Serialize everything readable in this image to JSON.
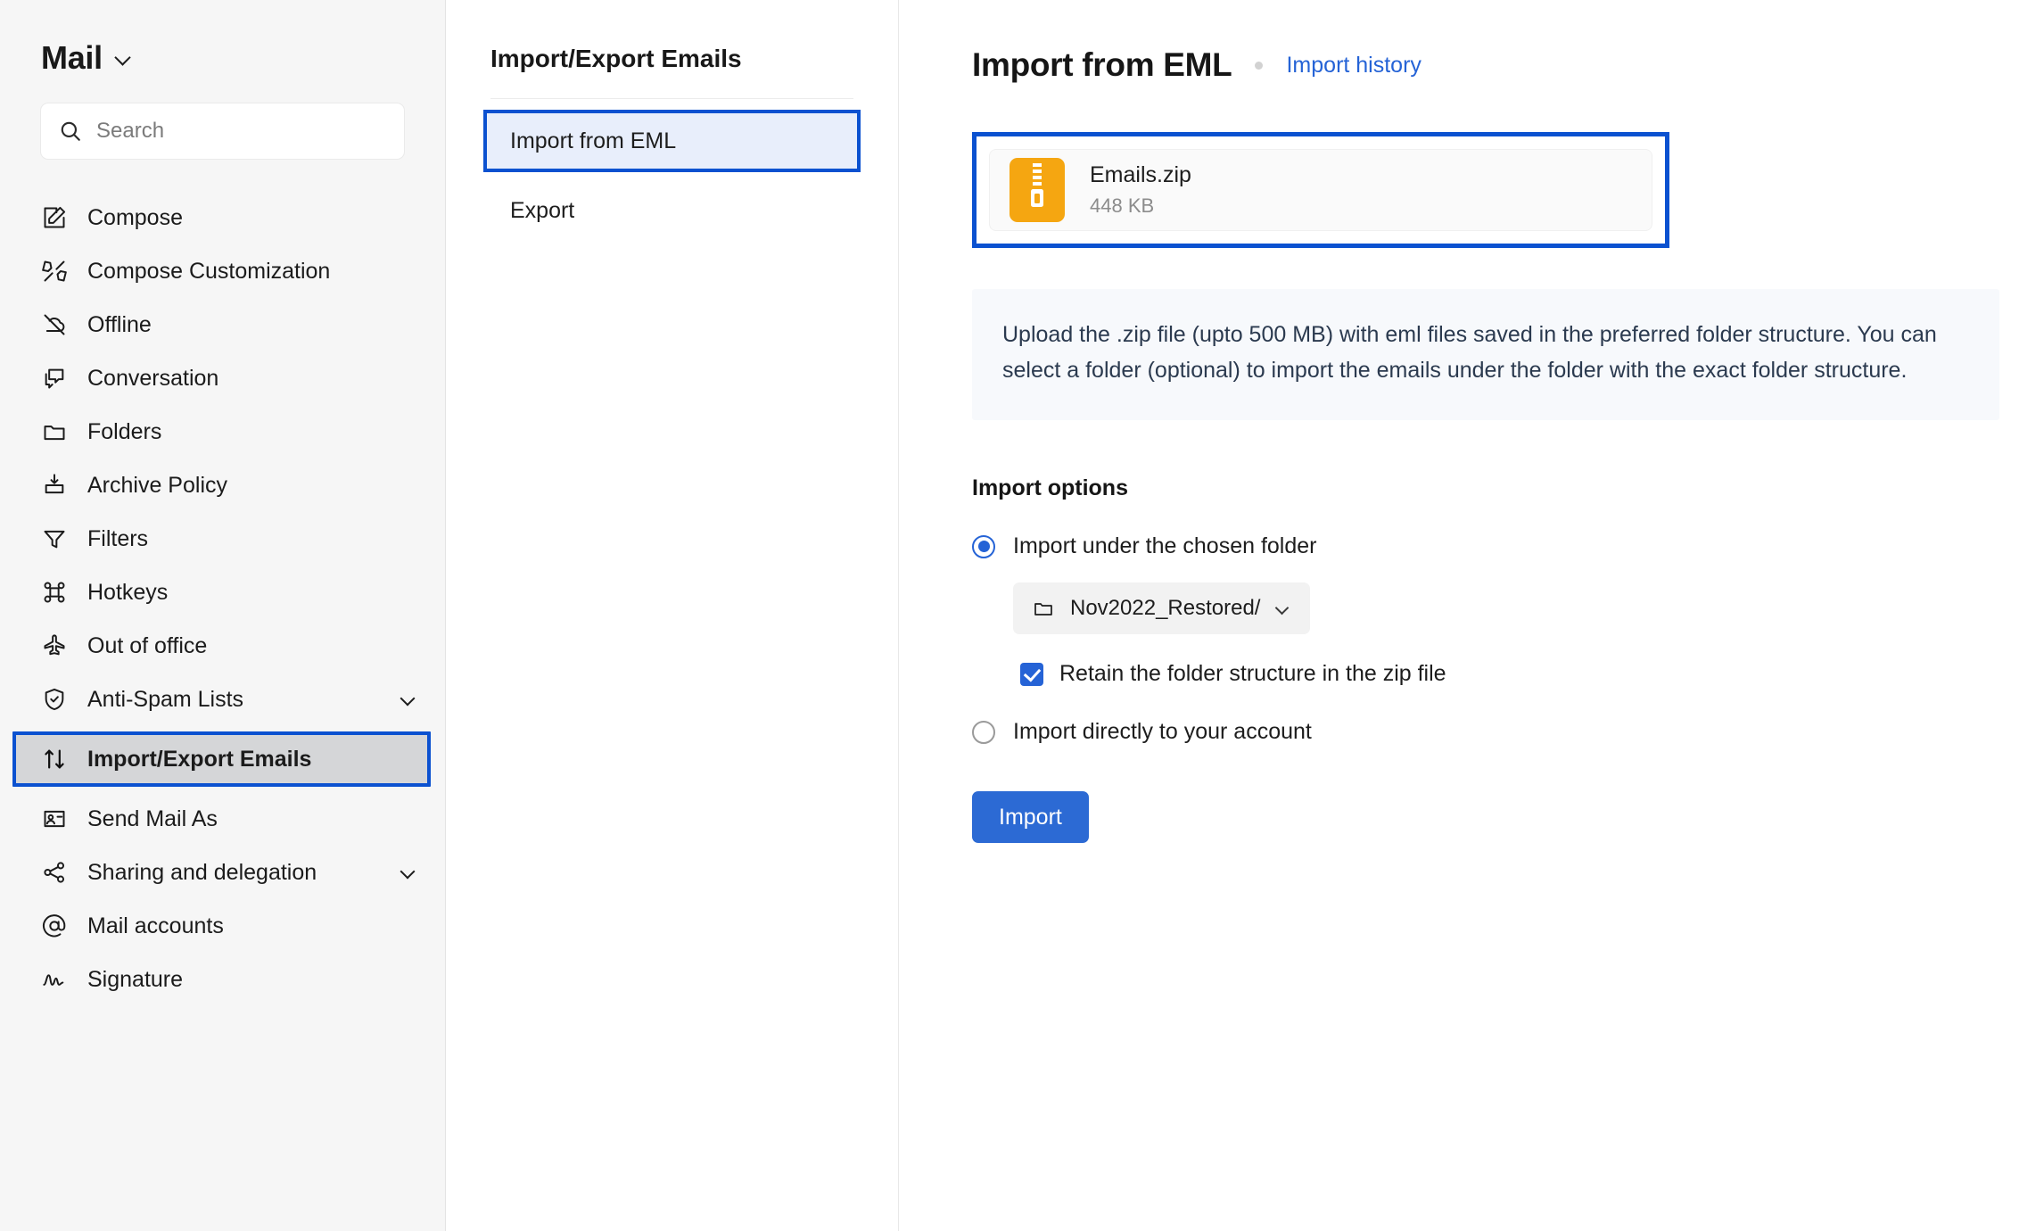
{
  "sidebar": {
    "title": "Mail",
    "search_placeholder": "Search",
    "items": [
      {
        "label": "Compose",
        "icon": "compose-icon",
        "chevron": false,
        "active": false
      },
      {
        "label": "Compose Customization",
        "icon": "tools-icon",
        "chevron": false,
        "active": false
      },
      {
        "label": "Offline",
        "icon": "cloud-off-icon",
        "chevron": false,
        "active": false
      },
      {
        "label": "Conversation",
        "icon": "chat-icon",
        "chevron": false,
        "active": false
      },
      {
        "label": "Folders",
        "icon": "folder-icon",
        "chevron": false,
        "active": false
      },
      {
        "label": "Archive Policy",
        "icon": "archive-icon",
        "chevron": false,
        "active": false
      },
      {
        "label": "Filters",
        "icon": "funnel-icon",
        "chevron": false,
        "active": false
      },
      {
        "label": "Hotkeys",
        "icon": "command-icon",
        "chevron": false,
        "active": false
      },
      {
        "label": "Out of office",
        "icon": "airplane-icon",
        "chevron": false,
        "active": false
      },
      {
        "label": "Anti-Spam Lists",
        "icon": "shield-check-icon",
        "chevron": true,
        "active": false
      },
      {
        "label": "Import/Export Emails",
        "icon": "arrows-up-down-icon",
        "chevron": false,
        "active": true
      },
      {
        "label": "Send Mail As",
        "icon": "contact-card-icon",
        "chevron": false,
        "active": false
      },
      {
        "label": "Sharing and delegation",
        "icon": "share-nodes-icon",
        "chevron": true,
        "active": false
      },
      {
        "label": "Mail accounts",
        "icon": "at-sign-icon",
        "chevron": false,
        "active": false
      },
      {
        "label": "Signature",
        "icon": "signature-icon",
        "chevron": false,
        "active": false
      }
    ]
  },
  "midpanel": {
    "title": "Import/Export Emails",
    "items": [
      {
        "label": "Import from EML",
        "active": true
      },
      {
        "label": "Export",
        "active": false
      }
    ]
  },
  "main": {
    "title": "Import from EML",
    "history_link": "Import history",
    "file": {
      "name": "Emails.zip",
      "size": "448 KB",
      "icon": "zip-file-icon",
      "icon_color": "#f5a611"
    },
    "info_text": "Upload the .zip file (upto 500 MB) with eml files saved in the preferred folder structure. You can select a folder (optional) to import the emails under the folder with the exact folder structure.",
    "options": {
      "heading": "Import options",
      "radio_chosen_folder": "Import under the chosen folder",
      "folder_value": "Nov2022_Restored/",
      "retain_structure": "Retain the folder structure in the zip file",
      "radio_direct": "Import directly to your account"
    },
    "import_button": "Import"
  },
  "colors": {
    "accent_blue": "#2563d6",
    "highlight_border": "#0b51d0",
    "button_blue": "#2c6ad4",
    "zip_orange": "#f5a611"
  }
}
